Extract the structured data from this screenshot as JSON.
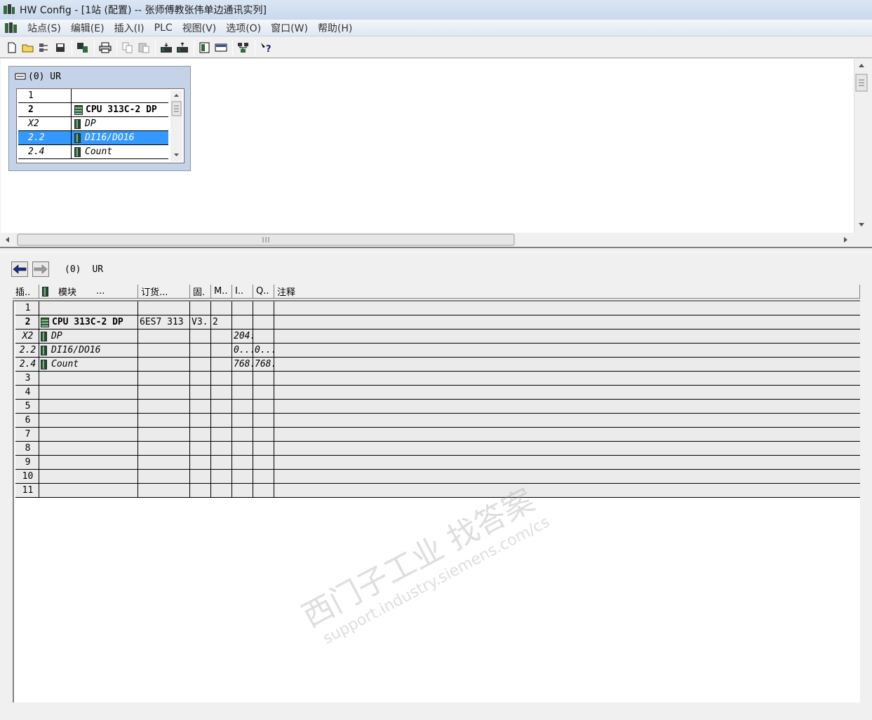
{
  "window": {
    "title": "HW Config - [1站 (配置) -- 张师傅教张伟单边通讯实列]"
  },
  "menu": [
    "站点(S)",
    "编辑(E)",
    "插入(I)",
    "PLC",
    "视图(V)",
    "选项(O)",
    "窗口(W)",
    "帮助(H)"
  ],
  "toolbar": {
    "icons": [
      "new-icon",
      "open-icon",
      "network-icon",
      "save-icon",
      "save-compile-icon",
      "print-icon",
      "copy-icon",
      "paste-icon",
      "download-icon",
      "upload-icon",
      "catalog-icon",
      "module-icon",
      "netpro-icon",
      "help-icon"
    ]
  },
  "rack": {
    "title": "(0)  UR",
    "rows": [
      {
        "slot": "1",
        "module": ""
      },
      {
        "slot": "2",
        "module": "CPU 313C-2 DP"
      },
      {
        "slot": "X2",
        "module": "DP"
      },
      {
        "slot": "2.2",
        "module": "DI16/DO16"
      },
      {
        "slot": "2.4",
        "module": "Count"
      }
    ]
  },
  "detail": {
    "nav_station": "(0)",
    "nav_rack": "UR",
    "headers": {
      "slot": "插..",
      "module": "模块",
      "module_more": "...",
      "order": "订货...",
      "firmware": "固.",
      "mpi": "M..",
      "i_addr": "I..",
      "q_addr": "Q..",
      "comment": "注释"
    },
    "rows": [
      {
        "slot": "1",
        "module": "",
        "order": "",
        "fw": "",
        "mpi": "",
        "i": "",
        "q": ""
      },
      {
        "slot": "2",
        "module": "CPU 313C-2 DP",
        "order": "6ES7 313",
        "fw": "V3.",
        "mpi": "2",
        "i": "",
        "q": ""
      },
      {
        "slot": "X2",
        "module": "DP",
        "order": "",
        "fw": "",
        "mpi": "",
        "i": "204:",
        "q": ""
      },
      {
        "slot": "2.2",
        "module": "DI16/DO16",
        "order": "",
        "fw": "",
        "mpi": "",
        "i": "0...",
        "q": "0..."
      },
      {
        "slot": "2.4",
        "module": "Count",
        "order": "",
        "fw": "",
        "mpi": "",
        "i": "768.",
        "q": "768."
      },
      {
        "slot": "3",
        "module": "",
        "order": "",
        "fw": "",
        "mpi": "",
        "i": "",
        "q": ""
      },
      {
        "slot": "4",
        "module": "",
        "order": "",
        "fw": "",
        "mpi": "",
        "i": "",
        "q": ""
      },
      {
        "slot": "5",
        "module": "",
        "order": "",
        "fw": "",
        "mpi": "",
        "i": "",
        "q": ""
      },
      {
        "slot": "6",
        "module": "",
        "order": "",
        "fw": "",
        "mpi": "",
        "i": "",
        "q": ""
      },
      {
        "slot": "7",
        "module": "",
        "order": "",
        "fw": "",
        "mpi": "",
        "i": "",
        "q": ""
      },
      {
        "slot": "8",
        "module": "",
        "order": "",
        "fw": "",
        "mpi": "",
        "i": "",
        "q": ""
      },
      {
        "slot": "9",
        "module": "",
        "order": "",
        "fw": "",
        "mpi": "",
        "i": "",
        "q": ""
      },
      {
        "slot": "10",
        "module": "",
        "order": "",
        "fw": "",
        "mpi": "",
        "i": "",
        "q": ""
      },
      {
        "slot": "11",
        "module": "",
        "order": "",
        "fw": "",
        "mpi": "",
        "i": "",
        "q": ""
      }
    ]
  },
  "watermark": {
    "line1": "西门子工业 找答案",
    "line2": "support.industry.siemens.com/cs"
  },
  "colors": {
    "selection": "#3399ff",
    "rack_bg": "#c5d3e8",
    "row_bg": "#ebebeb"
  }
}
